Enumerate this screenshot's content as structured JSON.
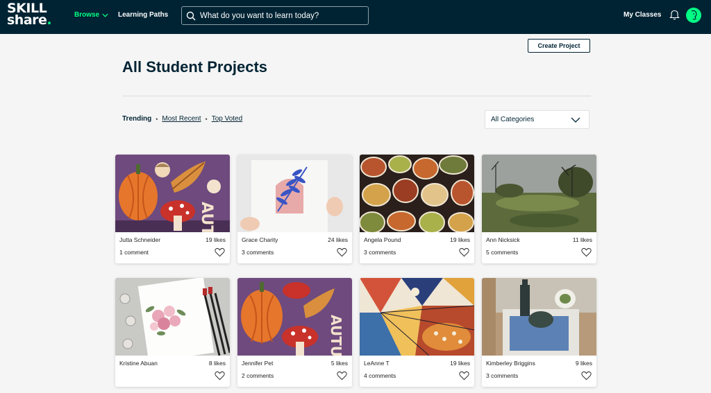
{
  "header": {
    "logo_line1": "SKILL",
    "logo_line2": "share",
    "logo_dot": ".",
    "browse_label": "Browse",
    "learning_paths_label": "Learning Paths",
    "search_placeholder": "What do you want to learn today?",
    "my_classes_label": "My Classes"
  },
  "page": {
    "create_project_label": "Create Project",
    "title": "All Student Projects"
  },
  "sort": {
    "active": "Trending",
    "sep": "•",
    "options": [
      "Most Recent",
      "Top Voted"
    ]
  },
  "category_select": {
    "selected": "All Categories"
  },
  "projects": [
    {
      "author": "Jutta Schneider",
      "likes": "19 likes",
      "comments": "1 comment",
      "art": "autumn-pumpkin"
    },
    {
      "author": "Grace Charity",
      "likes": "24 likes",
      "comments": "3 comments",
      "art": "leaf-print"
    },
    {
      "author": "Angela Pound",
      "likes": "19 likes",
      "comments": "3 comments",
      "art": "stone-pattern"
    },
    {
      "author": "Ann Nicksick",
      "likes": "11 likes",
      "comments": "5 comments",
      "art": "landscape"
    },
    {
      "author": "Kristine Abuan",
      "likes": "8 likes",
      "comments": "",
      "art": "floral-watercolor"
    },
    {
      "author": "Jennifer Pet",
      "likes": "5 likes",
      "comments": "2 comments",
      "art": "autumn-pumpkin"
    },
    {
      "author": "LeAnne T",
      "likes": "19 likes",
      "comments": "4 comments",
      "art": "geometric-collage"
    },
    {
      "author": "Kimberley Briggins",
      "likes": "9 likes",
      "comments": "3 comments",
      "art": "still-life"
    }
  ],
  "colors": {
    "nav_bg": "#002333",
    "accent": "#00ff84",
    "page_bg": "#f5f5f5"
  }
}
